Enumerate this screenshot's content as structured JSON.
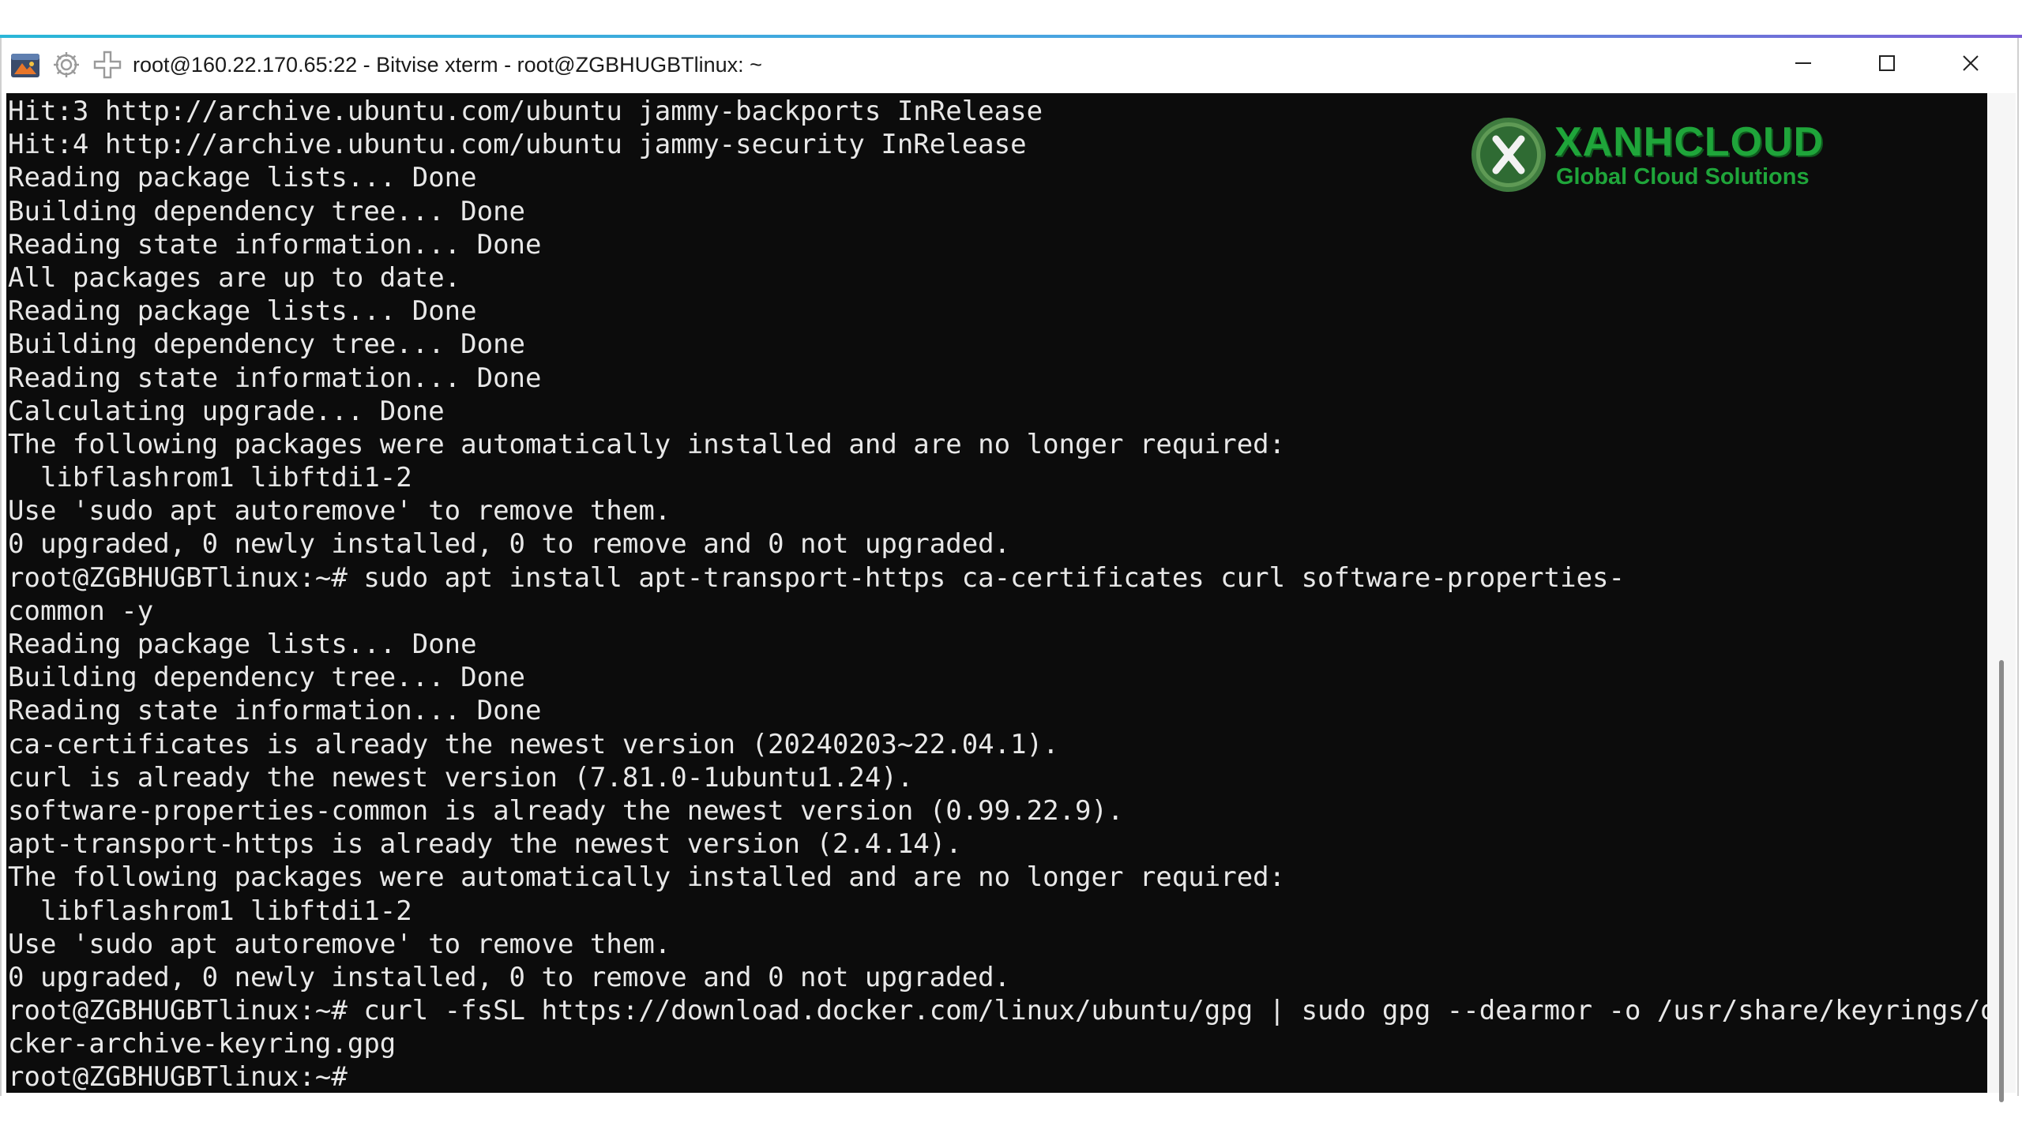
{
  "window": {
    "title": "root@160.22.170.65:22 - Bitvise xterm - root@ZGBHUGBTlinux: ~",
    "controls": {
      "minimize": "minimize-icon",
      "maximize": "maximize-icon",
      "close": "close-icon"
    }
  },
  "logo": {
    "brand": "XANHCLOUD",
    "tagline": "Global Cloud Solutions",
    "color": "#1fa53a"
  },
  "terminal": {
    "background": "#0c0c0c",
    "foreground": "#e8e8e8",
    "lines": [
      "Hit:3 http://archive.ubuntu.com/ubuntu jammy-backports InRelease",
      "Hit:4 http://archive.ubuntu.com/ubuntu jammy-security InRelease",
      "Reading package lists... Done",
      "Building dependency tree... Done",
      "Reading state information... Done",
      "All packages are up to date.",
      "Reading package lists... Done",
      "Building dependency tree... Done",
      "Reading state information... Done",
      "Calculating upgrade... Done",
      "The following packages were automatically installed and are no longer required:",
      "  libflashrom1 libftdi1-2",
      "Use 'sudo apt autoremove' to remove them.",
      "0 upgraded, 0 newly installed, 0 to remove and 0 not upgraded.",
      "root@ZGBHUGBTlinux:~# sudo apt install apt-transport-https ca-certificates curl software-properties-",
      "common -y",
      "Reading package lists... Done",
      "Building dependency tree... Done",
      "Reading state information... Done",
      "ca-certificates is already the newest version (20240203~22.04.1).",
      "curl is already the newest version (7.81.0-1ubuntu1.24).",
      "software-properties-common is already the newest version (0.99.22.9).",
      "apt-transport-https is already the newest version (2.4.14).",
      "The following packages were automatically installed and are no longer required:",
      "  libflashrom1 libftdi1-2",
      "Use 'sudo apt autoremove' to remove them.",
      "0 upgraded, 0 newly installed, 0 to remove and 0 not upgraded.",
      "root@ZGBHUGBTlinux:~# curl -fsSL https://download.docker.com/linux/ubuntu/gpg | sudo gpg --dearmor -o /usr/share/keyrings/do",
      "cker-archive-keyring.gpg",
      "root@ZGBHUGBTlinux:~#"
    ]
  }
}
